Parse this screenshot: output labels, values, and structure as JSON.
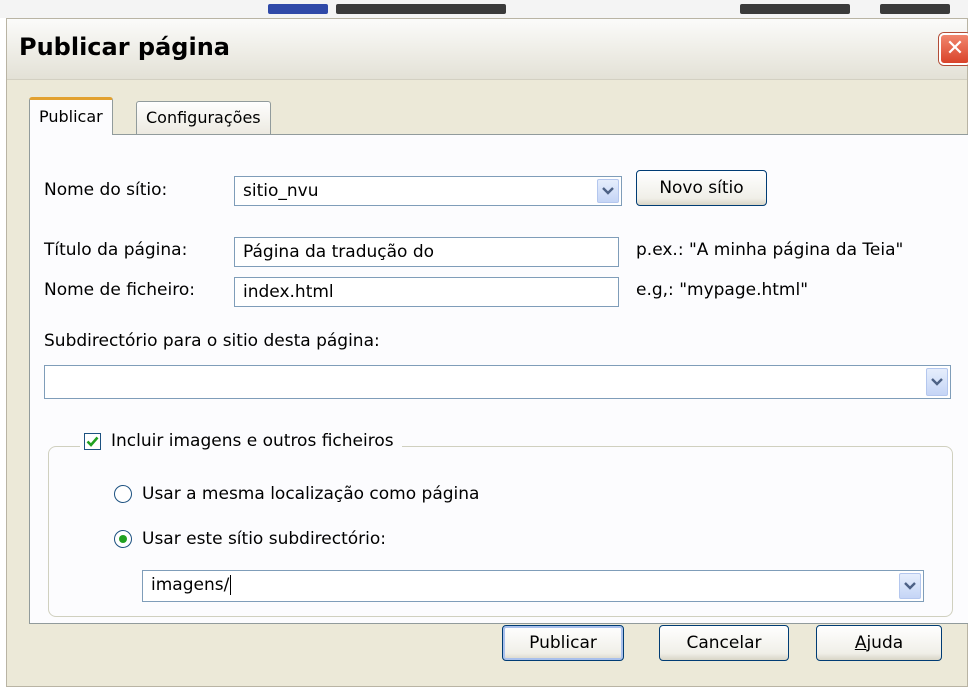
{
  "dialog": {
    "title": "Publicar página",
    "close_icon": "close-icon"
  },
  "tabs": [
    {
      "label": "Publicar",
      "active": true
    },
    {
      "label": "Configurações",
      "active": false
    }
  ],
  "form": {
    "site_name_label": "Nome do sítio:",
    "site_name_value": "sitio_nvu",
    "new_site_button": "Novo sítio",
    "page_title_label": "Título da página:",
    "page_title_value": "Página da tradução do",
    "page_title_hint": "p.ex.: \"A minha página da Teia\"",
    "filename_label": "Nome de ficheiro:",
    "filename_value": "index.html",
    "filename_hint": "e.g,: \"mypage.html\"",
    "subdir_label": "Subdirectório para o sitio desta página:",
    "subdir_value": ""
  },
  "images_group": {
    "include_label": "Incluir imagens e outros ficheiros",
    "include_checked": true,
    "option_same_location": "Usar a mesma localização como página",
    "option_subdir": "Usar este sítio subdirectório:",
    "selected_option": "subdir",
    "subdir_value": "imagens/"
  },
  "buttons": {
    "publish": "Publicar",
    "cancel": "Cancelar",
    "help_accel": "A",
    "help_rest": "juda"
  },
  "colors": {
    "dialog_bg": "#ece9d8",
    "panel_bg": "#fcfcfe",
    "close_red": "#d9432a",
    "tab_accent": "#e2a130",
    "radio_dot": "#21a121"
  }
}
